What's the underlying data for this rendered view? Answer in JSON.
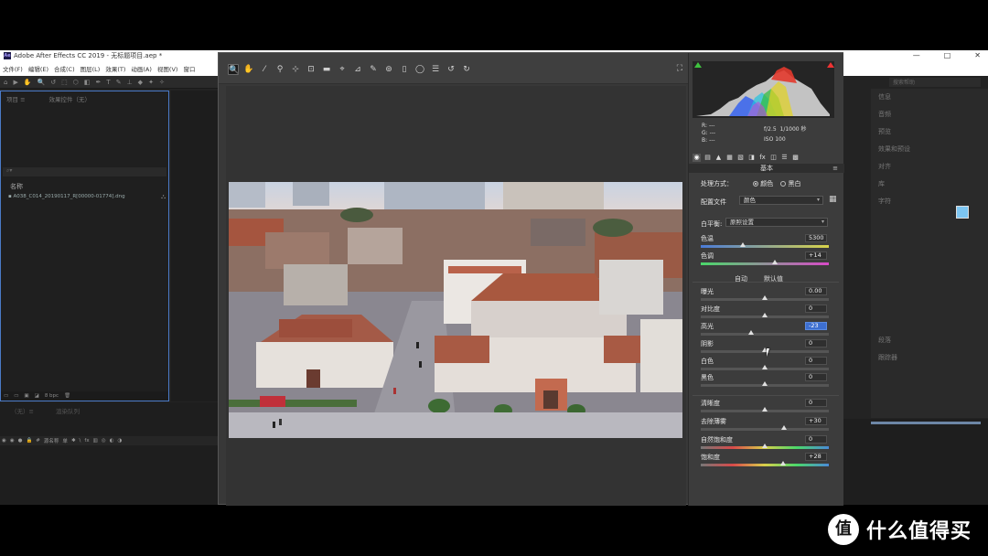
{
  "ae": {
    "title": "Adobe After Effects CC 2019 - 无标题项目.aep *",
    "logo": "Ae",
    "window_controls": [
      "—",
      "□",
      "✕"
    ],
    "menu": [
      "文件(F)",
      "编辑(E)",
      "合成(C)",
      "图层(L)",
      "效果(T)",
      "动画(A)",
      "视图(V)",
      "窗口"
    ],
    "toolbar_icons": [
      "⌂",
      "▶",
      "✋",
      "🔍",
      "↺",
      "⬚",
      "⬡",
      "◧",
      "✒",
      "T",
      "✎",
      "⊥",
      "◆",
      "✦",
      "✧"
    ],
    "project_tabs": [
      "项目 ≡",
      "效果控件（无）"
    ],
    "search_placeholder": "⌕▾",
    "column_name": "名称",
    "file_name": "A038_C014_20190117_R[00000-01774].dng",
    "project_footer": [
      "▭",
      "▭",
      "▣",
      "◪",
      "8 bpc",
      "🗑"
    ],
    "timeline_tabs": [
      "（无）≡",
      "渲染队列"
    ],
    "timeline_cols": [
      "◉",
      "◉",
      "●",
      "🔒",
      "#",
      "源名称",
      "单",
      "✱",
      "\\",
      "fx",
      "▥",
      "◎",
      "◐",
      "◑"
    ],
    "right_search": "搜索帮助",
    "right_items": [
      "信息",
      "音频",
      "预览",
      "效果和预设",
      "对齐",
      "库",
      "字符",
      "",
      "",
      "",
      "",
      "",
      "",
      "",
      "段落",
      "跟踪器"
    ]
  },
  "cr": {
    "tools": [
      "🔍",
      "✋",
      "⁄",
      "⚲",
      "⊹",
      "⊡",
      "▬",
      "⌖",
      "⊿",
      "✎",
      "⊚",
      "▯",
      "◯",
      "☰",
      "↺",
      "↻"
    ],
    "selected_tool": "🔍",
    "fullscreen_icon": "⛶",
    "info": {
      "r_label": "R:",
      "g_label": "G:",
      "b_label": "B:",
      "r": "---",
      "g": "---",
      "b": "---",
      "aperture": "f/2.5",
      "shutter": "1/1000 秒",
      "iso": "ISO 100"
    },
    "panel_tabs": [
      "◉",
      "▤",
      "▲",
      "▦",
      "▧",
      "◨",
      "fx",
      "◫",
      "☰",
      "▩"
    ],
    "panel_title": "基本",
    "panel_menu": "≡",
    "treatment_label": "处理方式：",
    "treatment_color": "颜色",
    "treatment_bw": "黑白",
    "profile_label": "配置文件",
    "profile_value": "颜色",
    "wb_label": "白平衡:",
    "wb_value": "原照设置",
    "auto": "自动",
    "default": "默认值",
    "sliders": [
      {
        "label": "色温",
        "value": "5300",
        "pos": 0.33
      },
      {
        "label": "色调",
        "value": "+14",
        "pos": 0.58
      },
      {
        "label": "曝光",
        "value": "0.00",
        "pos": 0.5
      },
      {
        "label": "对比度",
        "value": "0",
        "pos": 0.5
      },
      {
        "label": "高光",
        "value": "-23",
        "pos": 0.39
      },
      {
        "label": "阴影",
        "value": "0",
        "pos": 0.5
      },
      {
        "label": "白色",
        "value": "0",
        "pos": 0.5
      },
      {
        "label": "黑色",
        "value": "0",
        "pos": 0.5
      },
      {
        "label": "清晰度",
        "value": "0",
        "pos": 0.5
      },
      {
        "label": "去除薄雾",
        "value": "+30",
        "pos": 0.65
      },
      {
        "label": "自然饱和度",
        "value": "0",
        "pos": 0.5
      },
      {
        "label": "饱和度",
        "value": "+28",
        "pos": 0.64
      }
    ]
  },
  "watermark": {
    "logo": "值",
    "text": "什么值得买"
  }
}
